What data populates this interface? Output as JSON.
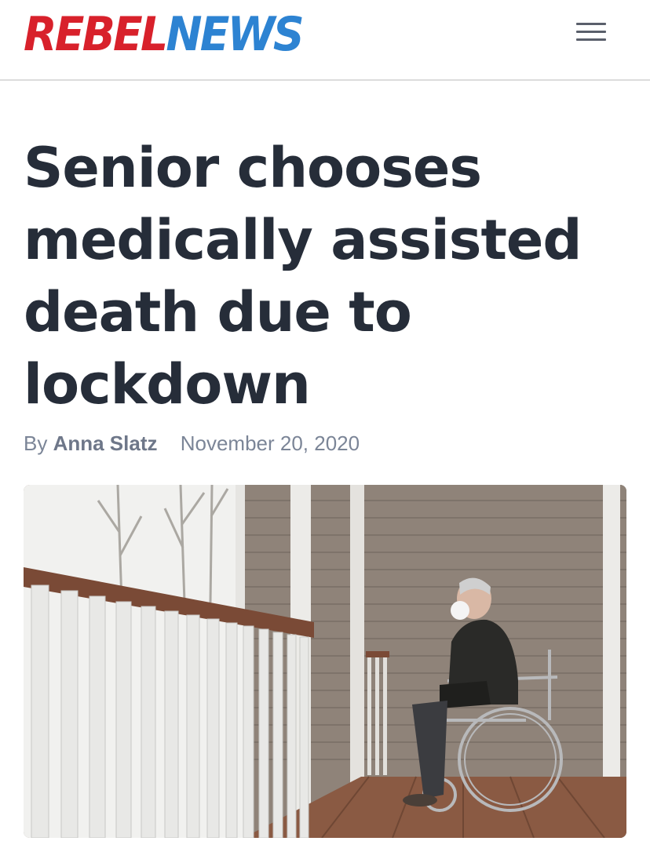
{
  "header": {
    "logo": {
      "part1": "REBEL",
      "part2": "NEWS"
    },
    "menu_icon": "hamburger-menu-icon"
  },
  "article": {
    "headline": "Senior chooses medically assisted death due to lockdown",
    "byline": {
      "prefix": "By",
      "author": "Anna Slatz",
      "date": "November 20, 2020"
    },
    "image_subject": "senior in wheelchair on porch"
  },
  "colors": {
    "logo_red": "#d8212b",
    "logo_blue": "#2d83d2",
    "headline": "#262d39",
    "byline": "#7b8597"
  }
}
